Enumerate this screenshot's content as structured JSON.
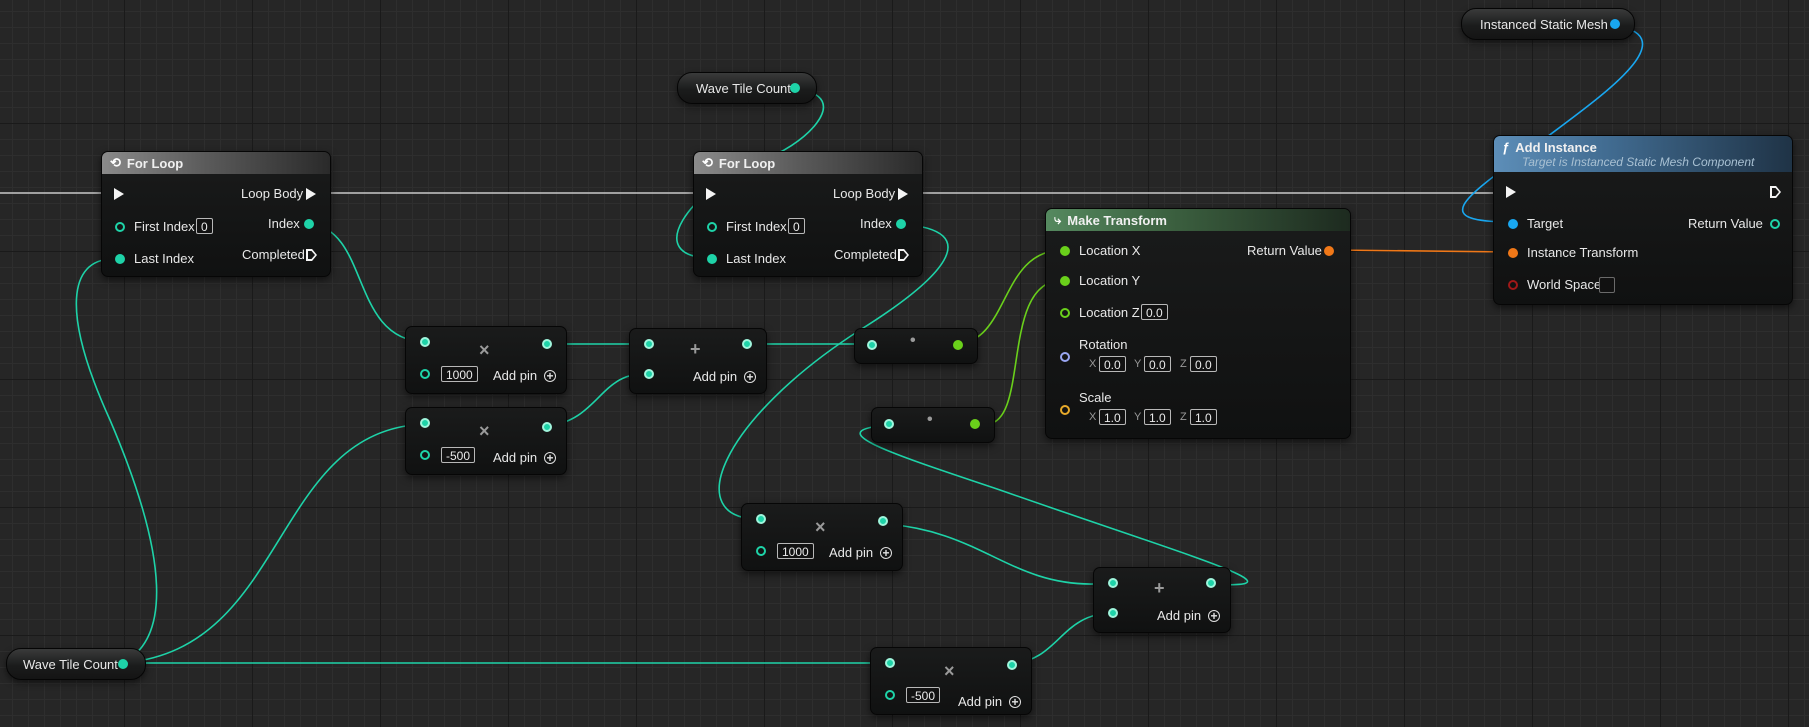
{
  "colors": {
    "background": "#262626",
    "int_wire": "#1ed3a8",
    "float_wire": "#6ad01b",
    "object_wire": "#19a7f0",
    "transform_wire": "#f07818",
    "exec_wire": "#e6e6e6"
  },
  "vars": {
    "wave_top": "Wave Tile Count",
    "wave_bottom": "Wave Tile Count",
    "ism": "Instanced Static Mesh"
  },
  "loop1": {
    "title": "For Loop",
    "loop_body": "Loop Body",
    "first_index": "First Index",
    "first_index_value": "0",
    "index": "Index",
    "last_index": "Last Index",
    "completed": "Completed"
  },
  "loop2": {
    "title": "For Loop",
    "loop_body": "Loop Body",
    "first_index": "First Index",
    "first_index_value": "0",
    "index": "Index",
    "last_index": "Last Index",
    "completed": "Completed"
  },
  "math": {
    "mul1": {
      "op": "×",
      "value": "1000",
      "add_pin": "Add pin"
    },
    "mul2": {
      "op": "×",
      "value": "-500",
      "add_pin": "Add pin"
    },
    "add1": {
      "op": "+",
      "add_pin": "Add pin"
    },
    "mul3": {
      "op": "×",
      "value": "1000",
      "add_pin": "Add pin"
    },
    "mul4": {
      "op": "×",
      "value": "-500",
      "add_pin": "Add pin"
    },
    "add2": {
      "op": "+",
      "add_pin": "Add pin"
    },
    "conv1": "•",
    "conv2": "•",
    "plus_icon": "+"
  },
  "make_transform": {
    "title": "Make Transform",
    "location_x": "Location X",
    "location_y": "Location Y",
    "location_z": "Location Z",
    "location_z_value": "0.0",
    "return_value": "Return Value",
    "rotation": "Rotation",
    "rot_x_label": "X",
    "rot_x": "0.0",
    "rot_y_label": "Y",
    "rot_y": "0.0",
    "rot_z_label": "Z",
    "rot_z": "0.0",
    "scale": "Scale",
    "scale_x_label": "X",
    "scale_x": "1.0",
    "scale_y_label": "Y",
    "scale_y": "1.0",
    "scale_z_label": "Z",
    "scale_z": "1.0"
  },
  "add_instance": {
    "icon": "ƒ",
    "title": "Add Instance",
    "subtitle": "Target is Instanced Static Mesh Component",
    "target": "Target",
    "return_value": "Return Value",
    "instance_transform": "Instance Transform",
    "world_space": "World Space"
  }
}
